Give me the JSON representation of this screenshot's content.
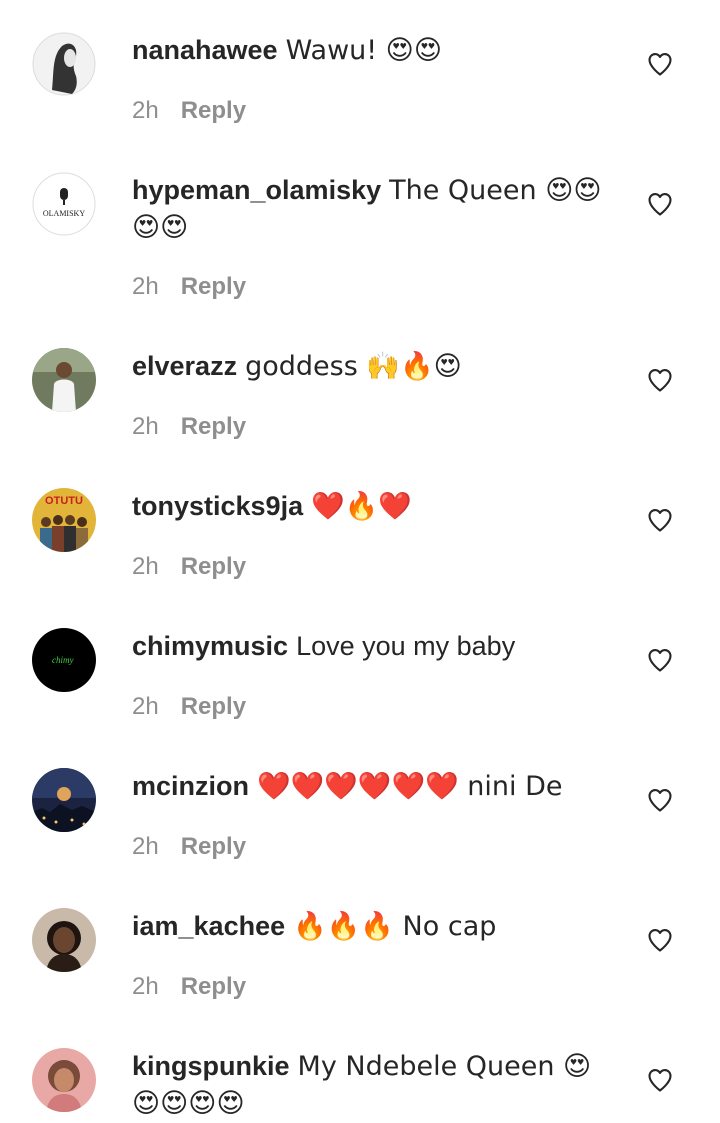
{
  "comments": [
    {
      "username": "nanahawee",
      "text": "Wawu! 😍😍",
      "time": "2h",
      "reply": "Reply"
    },
    {
      "username": "hypeman_olamisky",
      "text": "The Queen 😍😍😍😍",
      "time": "2h",
      "reply": "Reply",
      "avatar_text": "OLAMISKY"
    },
    {
      "username": "elverazz",
      "text": "goddess 🙌🔥😍",
      "time": "2h",
      "reply": "Reply"
    },
    {
      "username": "tonysticks9ja",
      "text": "❤️🔥❤️",
      "time": "2h",
      "reply": "Reply",
      "avatar_text": "OTUTU"
    },
    {
      "username": "chimymusic",
      "text": "Love you my baby",
      "time": "2h",
      "reply": "Reply",
      "avatar_text": "chimy"
    },
    {
      "username": "mcinzion",
      "text": "❤️❤️❤️❤️❤️❤️ nini De",
      "time": "2h",
      "reply": "Reply"
    },
    {
      "username": "iam_kachee",
      "text": "🔥🔥🔥 No cap",
      "time": "2h",
      "reply": "Reply"
    },
    {
      "username": "kingspunkie",
      "text": "My Ndebele Queen 😍😍😍😍😍"
    }
  ]
}
